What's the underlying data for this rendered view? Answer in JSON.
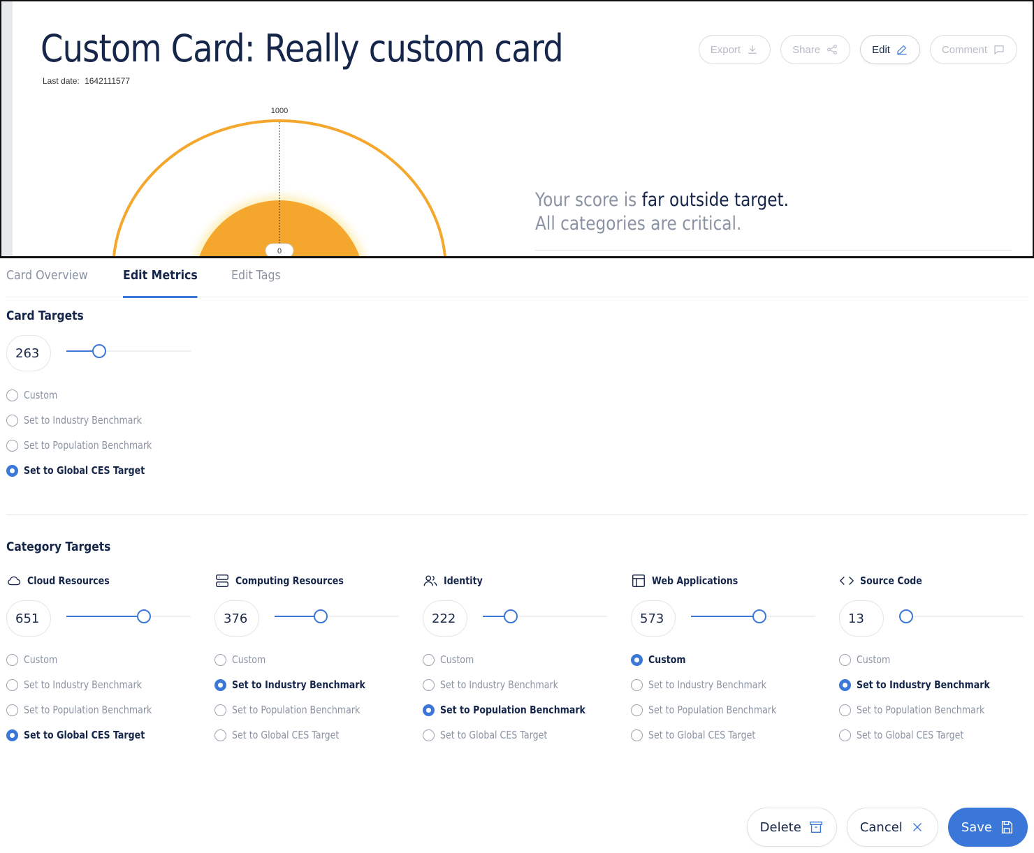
{
  "card": {
    "title": "Custom Card: Really custom card",
    "last_date_label": "Last date:",
    "last_date_value": "1642111577",
    "actions": [
      {
        "label": "Export",
        "icon": "download-icon",
        "active": false
      },
      {
        "label": "Share",
        "icon": "share-icon",
        "active": false
      },
      {
        "label": "Edit",
        "icon": "pencil-icon",
        "active": true
      },
      {
        "label": "Comment",
        "icon": "comment-icon",
        "active": false
      }
    ],
    "gauge": {
      "max_label": "1000",
      "value_label": "0",
      "arc_color": "#f4a72c",
      "glow_color": "#f6c12d"
    },
    "score_prefix": "Your score is ",
    "score_emphasis": "far outside target.",
    "score_line2": "All categories are critical."
  },
  "tabs": [
    {
      "label": "Card Overview",
      "active": false
    },
    {
      "label": "Edit Metrics",
      "active": true
    },
    {
      "label": "Edit Tags",
      "active": false
    }
  ],
  "card_targets": {
    "title": "Card Targets",
    "value": "263",
    "slider_fraction": 0.263,
    "options": [
      "Custom",
      "Set to Industry Benchmark",
      "Set to Population Benchmark",
      "Set to Global CES Target"
    ],
    "selected": 3
  },
  "category_targets": {
    "title": "Category Targets",
    "categories": [
      {
        "name": "Cloud Resources",
        "icon": "cloud-icon",
        "value": "651",
        "slider_fraction": 0.651,
        "selected": 3
      },
      {
        "name": "Computing Resources",
        "icon": "server-icon",
        "value": "376",
        "slider_fraction": 0.376,
        "selected": 1
      },
      {
        "name": "Identity",
        "icon": "users-icon",
        "value": "222",
        "slider_fraction": 0.222,
        "selected": 2
      },
      {
        "name": "Web Applications",
        "icon": "layout-icon",
        "value": "573",
        "slider_fraction": 0.573,
        "selected": 0
      },
      {
        "name": "Source Code",
        "icon": "code-icon",
        "value": "13",
        "slider_fraction": 0.013,
        "selected": 1
      }
    ],
    "options": [
      "Custom",
      "Set to Industry Benchmark",
      "Set to Population Benchmark",
      "Set to Global CES Target"
    ]
  },
  "footer": {
    "delete_label": "Delete",
    "cancel_label": "Cancel",
    "save_label": "Save"
  },
  "colors": {
    "accent": "#3b77d8",
    "text": "#15264a",
    "muted": "#8a93a3"
  }
}
